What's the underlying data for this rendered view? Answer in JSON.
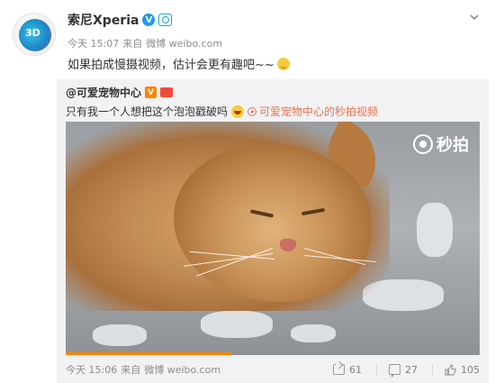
{
  "post": {
    "author": "索尼Xperia",
    "verified_badge": "V",
    "time": "今天 15:07",
    "source_prefix": "来自",
    "source": "微博 weibo.com",
    "text": "如果拍成慢摄视频，估计会更有趣吧~~"
  },
  "repost": {
    "author": "@可爱宠物中心",
    "verified_badge": "V",
    "text": "只有我一个人想把这个泡泡戳破吗",
    "video_link": "可爱宠物中心的秒拍视频",
    "watermark": "秒拍",
    "video_progress_pct": 40,
    "time": "今天 15:06",
    "source_prefix": "来自",
    "source": "微博 weibo.com",
    "reposts": "61",
    "comments": "27",
    "likes": "105"
  },
  "icons": {
    "avatar_label": "3D",
    "menu": "chevron-down-icon",
    "camera": "camera-badge-icon",
    "repost": "repost-icon",
    "comment": "comment-icon",
    "like": "thumbs-up-icon"
  },
  "colors": {
    "link": "#eb7350",
    "verified_blue": "#1d9bf0",
    "verified_orange": "#ff8200",
    "repost_bg": "#f2f2f5"
  }
}
